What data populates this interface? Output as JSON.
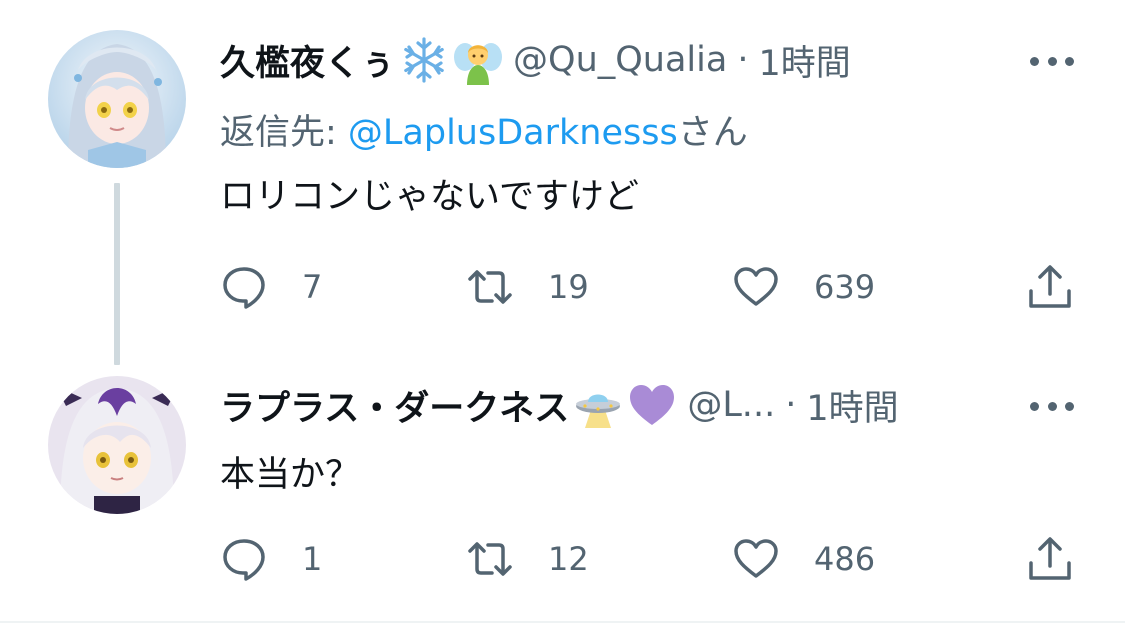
{
  "tweets": [
    {
      "display_name": "久檻夜くぅ",
      "name_emojis": [
        "snowflake-emoji",
        "fairy-emoji"
      ],
      "handle": "@Qu_Qualia",
      "separator": "·",
      "time": "1時間",
      "reply_prefix": "返信先: ",
      "reply_mention": "@LaplusDarknesss",
      "reply_suffix": "さん",
      "text": "ロリコンじゃないですけど",
      "replies": "7",
      "retweets": "19",
      "likes": "639"
    },
    {
      "display_name": "ラプラス・ダークネス",
      "name_emojis": [
        "ufo-emoji",
        "purple-heart-emoji"
      ],
      "handle": "@L...",
      "separator": "·",
      "time": "1時間",
      "text": "本当か？",
      "replies": "1",
      "retweets": "12",
      "likes": "486"
    }
  ],
  "colors": {
    "primary_text": "#0f1419",
    "secondary_text": "#536471",
    "link": "#1d9bf0",
    "thread_line": "#cfd9de"
  }
}
